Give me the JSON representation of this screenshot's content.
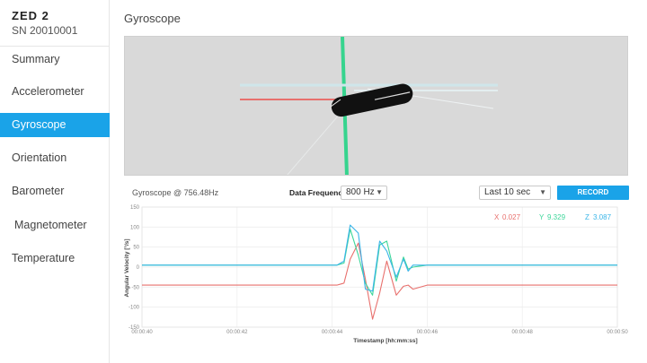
{
  "device": {
    "name": "ZED 2",
    "serial": "SN 20010001"
  },
  "nav": {
    "items": [
      {
        "label": "Summary",
        "active": false
      },
      {
        "label": "Accelerometer",
        "active": false
      },
      {
        "label": "Gyroscope",
        "active": true
      },
      {
        "label": "Orientation",
        "active": false
      },
      {
        "label": "Barometer",
        "active": false
      },
      {
        "label": "Magnetometer",
        "active": false
      },
      {
        "label": "Temperature",
        "active": false
      }
    ]
  },
  "page": {
    "title": "Gyroscope"
  },
  "controls": {
    "rate_label": "Gyroscope @ 756.48Hz",
    "freq_label": "Data Frequency",
    "freq_value": "800 Hz",
    "window_value": "Last 10 sec",
    "record_label": "RECORD"
  },
  "colors": {
    "accent": "#1aa3e8",
    "x": "#e8706d",
    "y": "#3dd69a",
    "z": "#3ab5e8"
  },
  "readouts": {
    "x": {
      "name": "X",
      "value": "0.027"
    },
    "y": {
      "name": "Y",
      "value": "9.329"
    },
    "z": {
      "name": "Z",
      "value": "3.087"
    }
  },
  "chart_data": {
    "type": "line",
    "xlabel": "Timestamp [hh:mm:ss]",
    "ylabel": "Angular Velocity [°/s]",
    "ylim": [
      -150,
      150
    ],
    "yticks": [
      150,
      100,
      50,
      0,
      -50,
      -100,
      -150
    ],
    "xlim": [
      40,
      50
    ],
    "xticks": [
      40,
      42,
      44,
      46,
      48,
      50
    ],
    "xtick_labels": [
      "00:00:40",
      "00:00:42",
      "00:00:44",
      "00:00:46",
      "00:00:48",
      "00:00:50"
    ],
    "grid": true,
    "series": [
      {
        "name": "X",
        "color": "#e8706d",
        "x": [
          40,
          44.1,
          44.25,
          44.38,
          44.55,
          44.7,
          44.85,
          45.0,
          45.15,
          45.35,
          45.5,
          45.6,
          45.7,
          46,
          50
        ],
        "y": [
          -45,
          -45,
          -40,
          20,
          60,
          -30,
          -130,
          -65,
          15,
          -70,
          -48,
          -45,
          -55,
          -45,
          -45
        ]
      },
      {
        "name": "Y",
        "color": "#3dd69a",
        "x": [
          40,
          44.1,
          44.25,
          44.38,
          44.55,
          44.7,
          44.85,
          45.0,
          45.15,
          45.35,
          45.5,
          45.6,
          45.7,
          46,
          50
        ],
        "y": [
          5,
          5,
          10,
          95,
          30,
          -40,
          -70,
          55,
          65,
          -35,
          25,
          -5,
          0,
          5,
          5
        ]
      },
      {
        "name": "Z",
        "color": "#3ab5e8",
        "x": [
          40,
          44.1,
          44.25,
          44.38,
          44.55,
          44.7,
          44.85,
          45.0,
          45.15,
          45.35,
          45.5,
          45.6,
          45.7,
          46,
          50
        ],
        "y": [
          5,
          5,
          15,
          105,
          85,
          -55,
          -60,
          65,
          40,
          -25,
          20,
          -10,
          5,
          5,
          5
        ]
      }
    ]
  }
}
